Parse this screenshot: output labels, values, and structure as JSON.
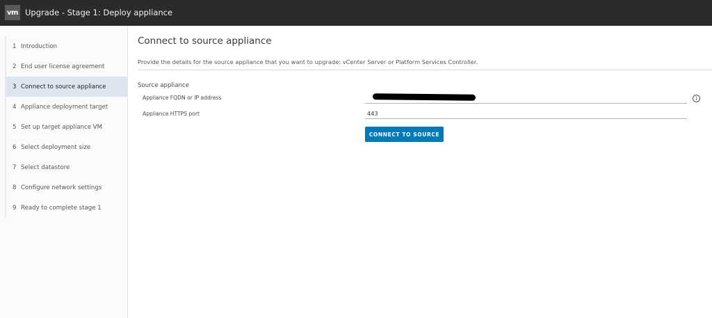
{
  "window": {
    "logo_text": "vm",
    "title": "Upgrade - Stage 1: Deploy appliance"
  },
  "sidebar": {
    "active_index": 2,
    "steps": [
      {
        "num": "1",
        "label": "Introduction"
      },
      {
        "num": "2",
        "label": "End user license agreement"
      },
      {
        "num": "3",
        "label": "Connect to source appliance"
      },
      {
        "num": "4",
        "label": "Appliance deployment target"
      },
      {
        "num": "5",
        "label": "Set up target appliance VM"
      },
      {
        "num": "6",
        "label": "Select deployment size"
      },
      {
        "num": "7",
        "label": "Select datastore"
      },
      {
        "num": "8",
        "label": "Configure network settings"
      },
      {
        "num": "9",
        "label": "Ready to complete stage 1"
      }
    ]
  },
  "main": {
    "title": "Connect to source appliance",
    "description": "Provide the details for the source appliance that you want to upgrade: vCenter Server or Platform Services Controller.",
    "section_label": "Source appliance",
    "fqdn_label": "Appliance FQDN or IP address",
    "fqdn_value": "",
    "port_label": "Appliance HTTPS port",
    "port_value": "443",
    "info_icon_glyph": "i",
    "connect_button": "CONNECT TO SOURCE"
  },
  "colors": {
    "titlebar_bg": "#2b2b2b",
    "accent": "#0079b8",
    "active_step_bg": "#dde6ef"
  }
}
